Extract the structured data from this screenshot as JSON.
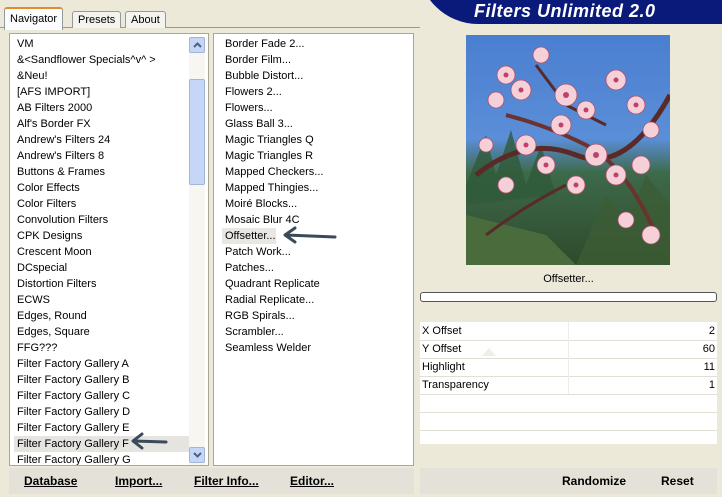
{
  "tabs": [
    {
      "label": "Navigator",
      "active": true
    },
    {
      "label": "Presets",
      "active": false
    },
    {
      "label": "About",
      "active": false
    }
  ],
  "banner": {
    "title": "Filters Unlimited 2.0",
    "color": "#0a1a7a"
  },
  "categories": {
    "items": [
      "VM",
      "&<Sandflower Specials^v^ >",
      "&Neu!",
      "[AFS IMPORT]",
      "AB Filters 2000",
      "Alf's Border FX",
      "Andrew's Filters 24",
      "Andrew's Filters 8",
      "Buttons & Frames",
      "Color Effects",
      "Color Filters",
      "Convolution Filters",
      "CPK Designs",
      "Crescent Moon",
      "DCspecial",
      "Distortion Filters",
      "ECWS",
      "Edges, Round",
      "Edges, Square",
      "FFG???",
      "Filter Factory Gallery A",
      "Filter Factory Gallery B",
      "Filter Factory Gallery C",
      "Filter Factory Gallery D",
      "Filter Factory Gallery E",
      "Filter Factory Gallery F",
      "Filter Factory Gallery G"
    ],
    "selected": "Filter Factory Gallery F"
  },
  "filters": {
    "items": [
      "Border Fade 2...",
      "Border Film...",
      "Bubble Distort...",
      "Flowers 2...",
      "Flowers...",
      "Glass Ball 3...",
      "Magic Triangles Q",
      "Magic Triangles R",
      "Mapped Checkers...",
      "Mapped Thingies...",
      "Moiré Blocks...",
      "Mosaic Blur 4C",
      "Offsetter...",
      "Patch Work...",
      "Patches...",
      "Quadrant Replicate",
      "Radial Replicate...",
      "RGB Spirals...",
      "Scrambler...",
      "Seamless Welder"
    ],
    "selected": "Offsetter..."
  },
  "preview": {
    "filter_name": "Offsetter...",
    "progress": 0
  },
  "parameters": [
    {
      "name": "X Offset",
      "value": "2"
    },
    {
      "name": "Y Offset",
      "value": "60"
    },
    {
      "name": "Highlight",
      "value": "11"
    },
    {
      "name": "Transparency",
      "value": "1"
    }
  ],
  "buttons": {
    "database": "Database",
    "import": "Import...",
    "filter_info": "Filter Info...",
    "editor": "Editor...",
    "randomize": "Randomize",
    "reset": "Reset"
  },
  "colors": {
    "accent_tab": "#e68b2c",
    "scroll": "#c6d6f7",
    "arrow": "#3b4a5a"
  }
}
